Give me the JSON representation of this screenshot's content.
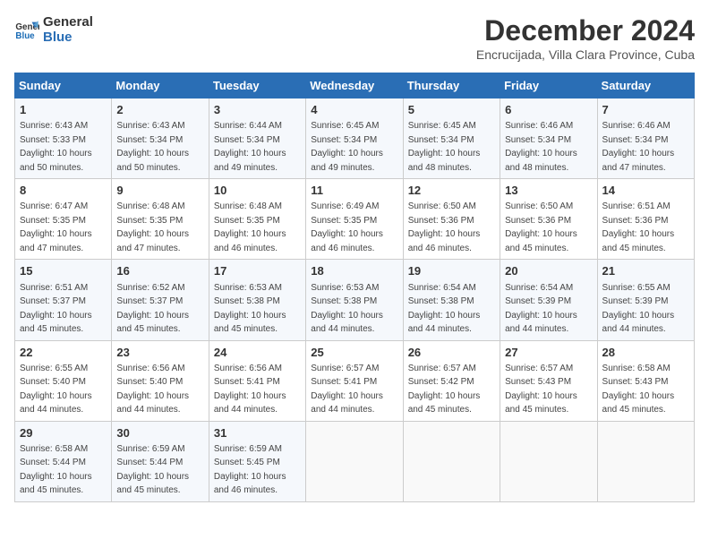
{
  "logo": {
    "line1": "General",
    "line2": "Blue"
  },
  "title": "December 2024",
  "subtitle": "Encrucijada, Villa Clara Province, Cuba",
  "headers": [
    "Sunday",
    "Monday",
    "Tuesday",
    "Wednesday",
    "Thursday",
    "Friday",
    "Saturday"
  ],
  "weeks": [
    [
      {
        "day": "1",
        "sunrise": "6:43 AM",
        "sunset": "5:33 PM",
        "daylight": "10 hours and 50 minutes."
      },
      {
        "day": "2",
        "sunrise": "6:43 AM",
        "sunset": "5:34 PM",
        "daylight": "10 hours and 50 minutes."
      },
      {
        "day": "3",
        "sunrise": "6:44 AM",
        "sunset": "5:34 PM",
        "daylight": "10 hours and 49 minutes."
      },
      {
        "day": "4",
        "sunrise": "6:45 AM",
        "sunset": "5:34 PM",
        "daylight": "10 hours and 49 minutes."
      },
      {
        "day": "5",
        "sunrise": "6:45 AM",
        "sunset": "5:34 PM",
        "daylight": "10 hours and 48 minutes."
      },
      {
        "day": "6",
        "sunrise": "6:46 AM",
        "sunset": "5:34 PM",
        "daylight": "10 hours and 48 minutes."
      },
      {
        "day": "7",
        "sunrise": "6:46 AM",
        "sunset": "5:34 PM",
        "daylight": "10 hours and 47 minutes."
      }
    ],
    [
      {
        "day": "8",
        "sunrise": "6:47 AM",
        "sunset": "5:35 PM",
        "daylight": "10 hours and 47 minutes."
      },
      {
        "day": "9",
        "sunrise": "6:48 AM",
        "sunset": "5:35 PM",
        "daylight": "10 hours and 47 minutes."
      },
      {
        "day": "10",
        "sunrise": "6:48 AM",
        "sunset": "5:35 PM",
        "daylight": "10 hours and 46 minutes."
      },
      {
        "day": "11",
        "sunrise": "6:49 AM",
        "sunset": "5:35 PM",
        "daylight": "10 hours and 46 minutes."
      },
      {
        "day": "12",
        "sunrise": "6:50 AM",
        "sunset": "5:36 PM",
        "daylight": "10 hours and 46 minutes."
      },
      {
        "day": "13",
        "sunrise": "6:50 AM",
        "sunset": "5:36 PM",
        "daylight": "10 hours and 45 minutes."
      },
      {
        "day": "14",
        "sunrise": "6:51 AM",
        "sunset": "5:36 PM",
        "daylight": "10 hours and 45 minutes."
      }
    ],
    [
      {
        "day": "15",
        "sunrise": "6:51 AM",
        "sunset": "5:37 PM",
        "daylight": "10 hours and 45 minutes."
      },
      {
        "day": "16",
        "sunrise": "6:52 AM",
        "sunset": "5:37 PM",
        "daylight": "10 hours and 45 minutes."
      },
      {
        "day": "17",
        "sunrise": "6:53 AM",
        "sunset": "5:38 PM",
        "daylight": "10 hours and 45 minutes."
      },
      {
        "day": "18",
        "sunrise": "6:53 AM",
        "sunset": "5:38 PM",
        "daylight": "10 hours and 44 minutes."
      },
      {
        "day": "19",
        "sunrise": "6:54 AM",
        "sunset": "5:38 PM",
        "daylight": "10 hours and 44 minutes."
      },
      {
        "day": "20",
        "sunrise": "6:54 AM",
        "sunset": "5:39 PM",
        "daylight": "10 hours and 44 minutes."
      },
      {
        "day": "21",
        "sunrise": "6:55 AM",
        "sunset": "5:39 PM",
        "daylight": "10 hours and 44 minutes."
      }
    ],
    [
      {
        "day": "22",
        "sunrise": "6:55 AM",
        "sunset": "5:40 PM",
        "daylight": "10 hours and 44 minutes."
      },
      {
        "day": "23",
        "sunrise": "6:56 AM",
        "sunset": "5:40 PM",
        "daylight": "10 hours and 44 minutes."
      },
      {
        "day": "24",
        "sunrise": "6:56 AM",
        "sunset": "5:41 PM",
        "daylight": "10 hours and 44 minutes."
      },
      {
        "day": "25",
        "sunrise": "6:57 AM",
        "sunset": "5:41 PM",
        "daylight": "10 hours and 44 minutes."
      },
      {
        "day": "26",
        "sunrise": "6:57 AM",
        "sunset": "5:42 PM",
        "daylight": "10 hours and 45 minutes."
      },
      {
        "day": "27",
        "sunrise": "6:57 AM",
        "sunset": "5:43 PM",
        "daylight": "10 hours and 45 minutes."
      },
      {
        "day": "28",
        "sunrise": "6:58 AM",
        "sunset": "5:43 PM",
        "daylight": "10 hours and 45 minutes."
      }
    ],
    [
      {
        "day": "29",
        "sunrise": "6:58 AM",
        "sunset": "5:44 PM",
        "daylight": "10 hours and 45 minutes."
      },
      {
        "day": "30",
        "sunrise": "6:59 AM",
        "sunset": "5:44 PM",
        "daylight": "10 hours and 45 minutes."
      },
      {
        "day": "31",
        "sunrise": "6:59 AM",
        "sunset": "5:45 PM",
        "daylight": "10 hours and 46 minutes."
      },
      null,
      null,
      null,
      null
    ]
  ],
  "labels": {
    "sunrise": "Sunrise: ",
    "sunset": "Sunset: ",
    "daylight": "Daylight: "
  }
}
